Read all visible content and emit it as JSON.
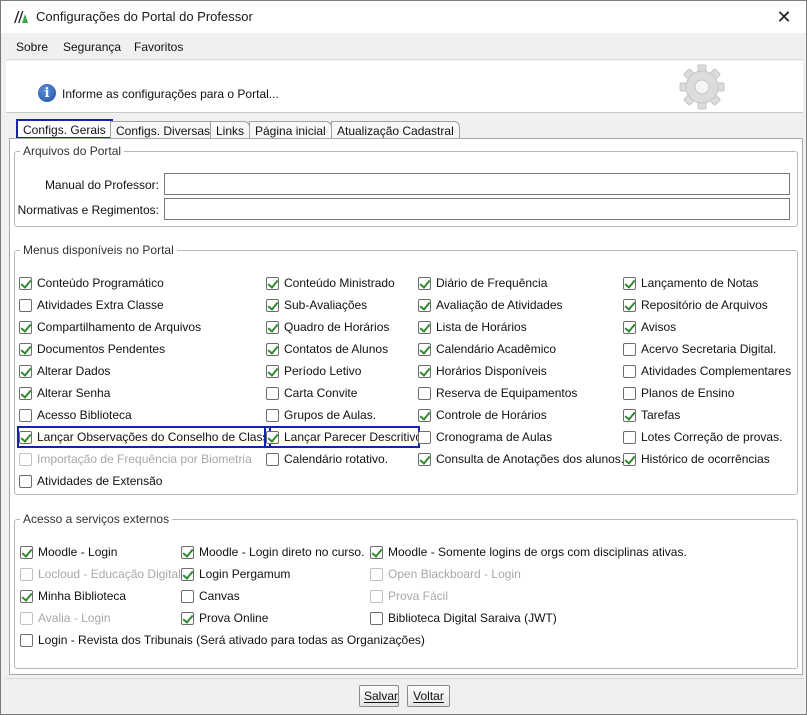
{
  "window": {
    "title": "Configurações do Portal do Professor",
    "close_glyph": "✕"
  },
  "menubar": {
    "items": [
      "Sobre",
      "Segurança",
      "Favoritos"
    ]
  },
  "info": {
    "text": "Informe as configurações para o Portal..."
  },
  "tabs": [
    "Configs. Gerais",
    "Configs. Diversas",
    "Links",
    "Página inicial",
    "Atualização Cadastral"
  ],
  "files_group": {
    "title": "Arquivos do Portal",
    "manual_label": "Manual do Professor:",
    "manual_value": "",
    "normativas_label": "Normativas e Regimentos:",
    "normativas_value": ""
  },
  "menus_group": {
    "title": "Menus disponíveis no Portal",
    "columns": [
      [
        {
          "label": "Conteúdo Programático",
          "checked": true
        },
        {
          "label": "Atividades Extra Classe",
          "checked": false
        },
        {
          "label": "Compartilhamento de Arquivos",
          "checked": true
        },
        {
          "label": "Documentos Pendentes",
          "checked": true
        },
        {
          "label": "Alterar Dados",
          "checked": true
        },
        {
          "label": "Alterar Senha",
          "checked": true
        },
        {
          "label": "Acesso Biblioteca",
          "checked": false
        },
        {
          "label": "Lançar Observações do Conselho de Classe",
          "checked": true,
          "highlight": true
        },
        {
          "label": "Importação de Frequência por Biometria",
          "checked": false,
          "disabled": true
        },
        {
          "label": "Atividades de Extensão",
          "checked": false
        }
      ],
      [
        {
          "label": "Conteúdo Ministrado",
          "checked": true
        },
        {
          "label": "Sub-Avaliações",
          "checked": true
        },
        {
          "label": "Quadro de Horários",
          "checked": true
        },
        {
          "label": "Contatos de Alunos",
          "checked": true
        },
        {
          "label": "Período Letivo",
          "checked": true
        },
        {
          "label": "Carta Convite",
          "checked": false
        },
        {
          "label": "Grupos de Aulas.",
          "checked": false
        },
        {
          "label": "Lançar Parecer Descritivo",
          "checked": true,
          "highlight": true
        },
        {
          "label": "Calendário rotativo.",
          "checked": false
        }
      ],
      [
        {
          "label": "Diário de Frequência",
          "checked": true
        },
        {
          "label": "Avaliação de Atividades",
          "checked": true
        },
        {
          "label": "Lista de Horários",
          "checked": true
        },
        {
          "label": "Calendário Acadêmico",
          "checked": true
        },
        {
          "label": "Horários Disponíveis",
          "checked": true
        },
        {
          "label": "Reserva de Equipamentos",
          "checked": false
        },
        {
          "label": "Controle de Horários",
          "checked": true
        },
        {
          "label": "Cronograma de Aulas",
          "checked": false
        },
        {
          "label": "Consulta de Anotações dos alunos.",
          "checked": true
        }
      ],
      [
        {
          "label": "Lançamento de Notas",
          "checked": true
        },
        {
          "label": "Repositório de Arquivos",
          "checked": true
        },
        {
          "label": "Avisos",
          "checked": true
        },
        {
          "label": "Acervo Secretaria Digital.",
          "checked": false
        },
        {
          "label": "Atividades Complementares",
          "checked": false
        },
        {
          "label": "Planos de Ensino",
          "checked": false
        },
        {
          "label": "Tarefas",
          "checked": true
        },
        {
          "label": "Lotes Correção de provas.",
          "checked": false
        },
        {
          "label": "Histórico de ocorrências",
          "checked": true
        }
      ]
    ]
  },
  "external_group": {
    "title": "Acesso a serviços externos",
    "columns": [
      [
        {
          "label": "Moodle - Login",
          "checked": true
        },
        {
          "label": "Locloud - Educação Digital",
          "checked": false,
          "disabled": true
        },
        {
          "label": "Minha Biblioteca",
          "checked": true
        },
        {
          "label": "Avalia - Login",
          "checked": false,
          "disabled": true
        },
        {
          "label": "Login - Revista dos Tribunais (Será ativado para todas as Organizações)",
          "checked": false
        }
      ],
      [
        {
          "label": "Moodle - Login direto no curso.",
          "checked": true
        },
        {
          "label": "Login Pergamum",
          "checked": true
        },
        {
          "label": "Canvas",
          "checked": false
        },
        {
          "label": "Prova Online",
          "checked": true
        }
      ],
      [
        {
          "label": "Moodle - Somente logins de orgs com disciplinas ativas.",
          "checked": true
        },
        {
          "label": "Open Blackboard - Login",
          "checked": false,
          "disabled": true
        },
        {
          "label": "Prova Fácil",
          "checked": false,
          "disabled": true
        },
        {
          "label": "Biblioteca Digital Saraiva (JWT)",
          "checked": false
        }
      ]
    ]
  },
  "buttons": {
    "save": "Salvar",
    "back": "Voltar"
  },
  "colors": {
    "highlight": "#1524a8",
    "check": "#2f8a2f"
  },
  "icons": {
    "info": "info-icon",
    "gear": "gear-icon",
    "app": "app-logo-icon",
    "close": "close-icon"
  }
}
